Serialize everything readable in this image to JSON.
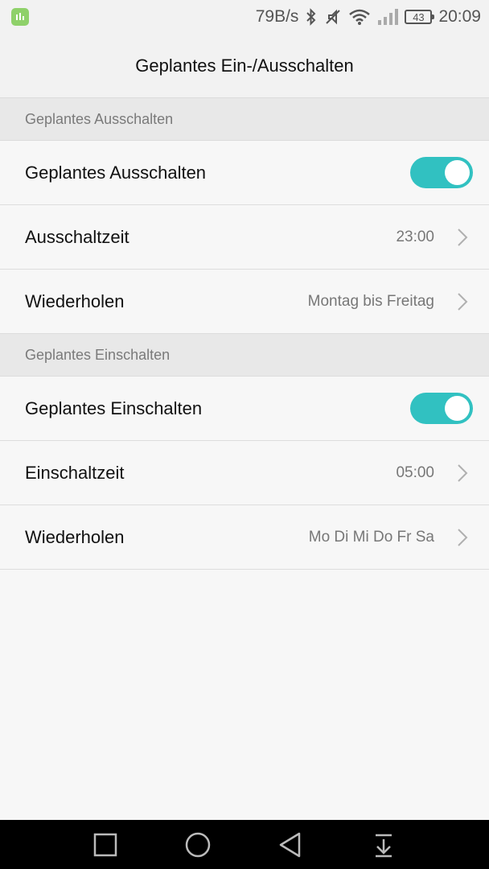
{
  "status_bar": {
    "app_icon": "app-notification-icon",
    "network_speed": "79B/s",
    "icons": [
      "bluetooth-icon",
      "silent-icon",
      "wifi-icon",
      "signal-icon"
    ],
    "battery_level": "43",
    "time": "20:09"
  },
  "title": "Geplantes Ein-/Ausschalten",
  "sections": [
    {
      "header": "Geplantes Ausschalten",
      "toggle": {
        "label": "Geplantes Ausschalten",
        "on": true
      },
      "time": {
        "label": "Ausschaltzeit",
        "value": "23:00"
      },
      "repeat": {
        "label": "Wiederholen",
        "value": "Montag bis Freitag"
      }
    },
    {
      "header": "Geplantes Einschalten",
      "toggle": {
        "label": "Geplantes Einschalten",
        "on": true
      },
      "time": {
        "label": "Einschaltzeit",
        "value": "05:00"
      },
      "repeat": {
        "label": "Wiederholen",
        "value": "Mo Di Mi Do Fr Sa"
      }
    }
  ],
  "colors": {
    "accent": "#31c1c1",
    "section_bg": "#e8e8e8",
    "navbar": "#000000"
  },
  "nav_bar": {
    "icons": [
      "recent-apps-icon",
      "home-icon",
      "back-icon",
      "notification-pull-icon"
    ]
  }
}
